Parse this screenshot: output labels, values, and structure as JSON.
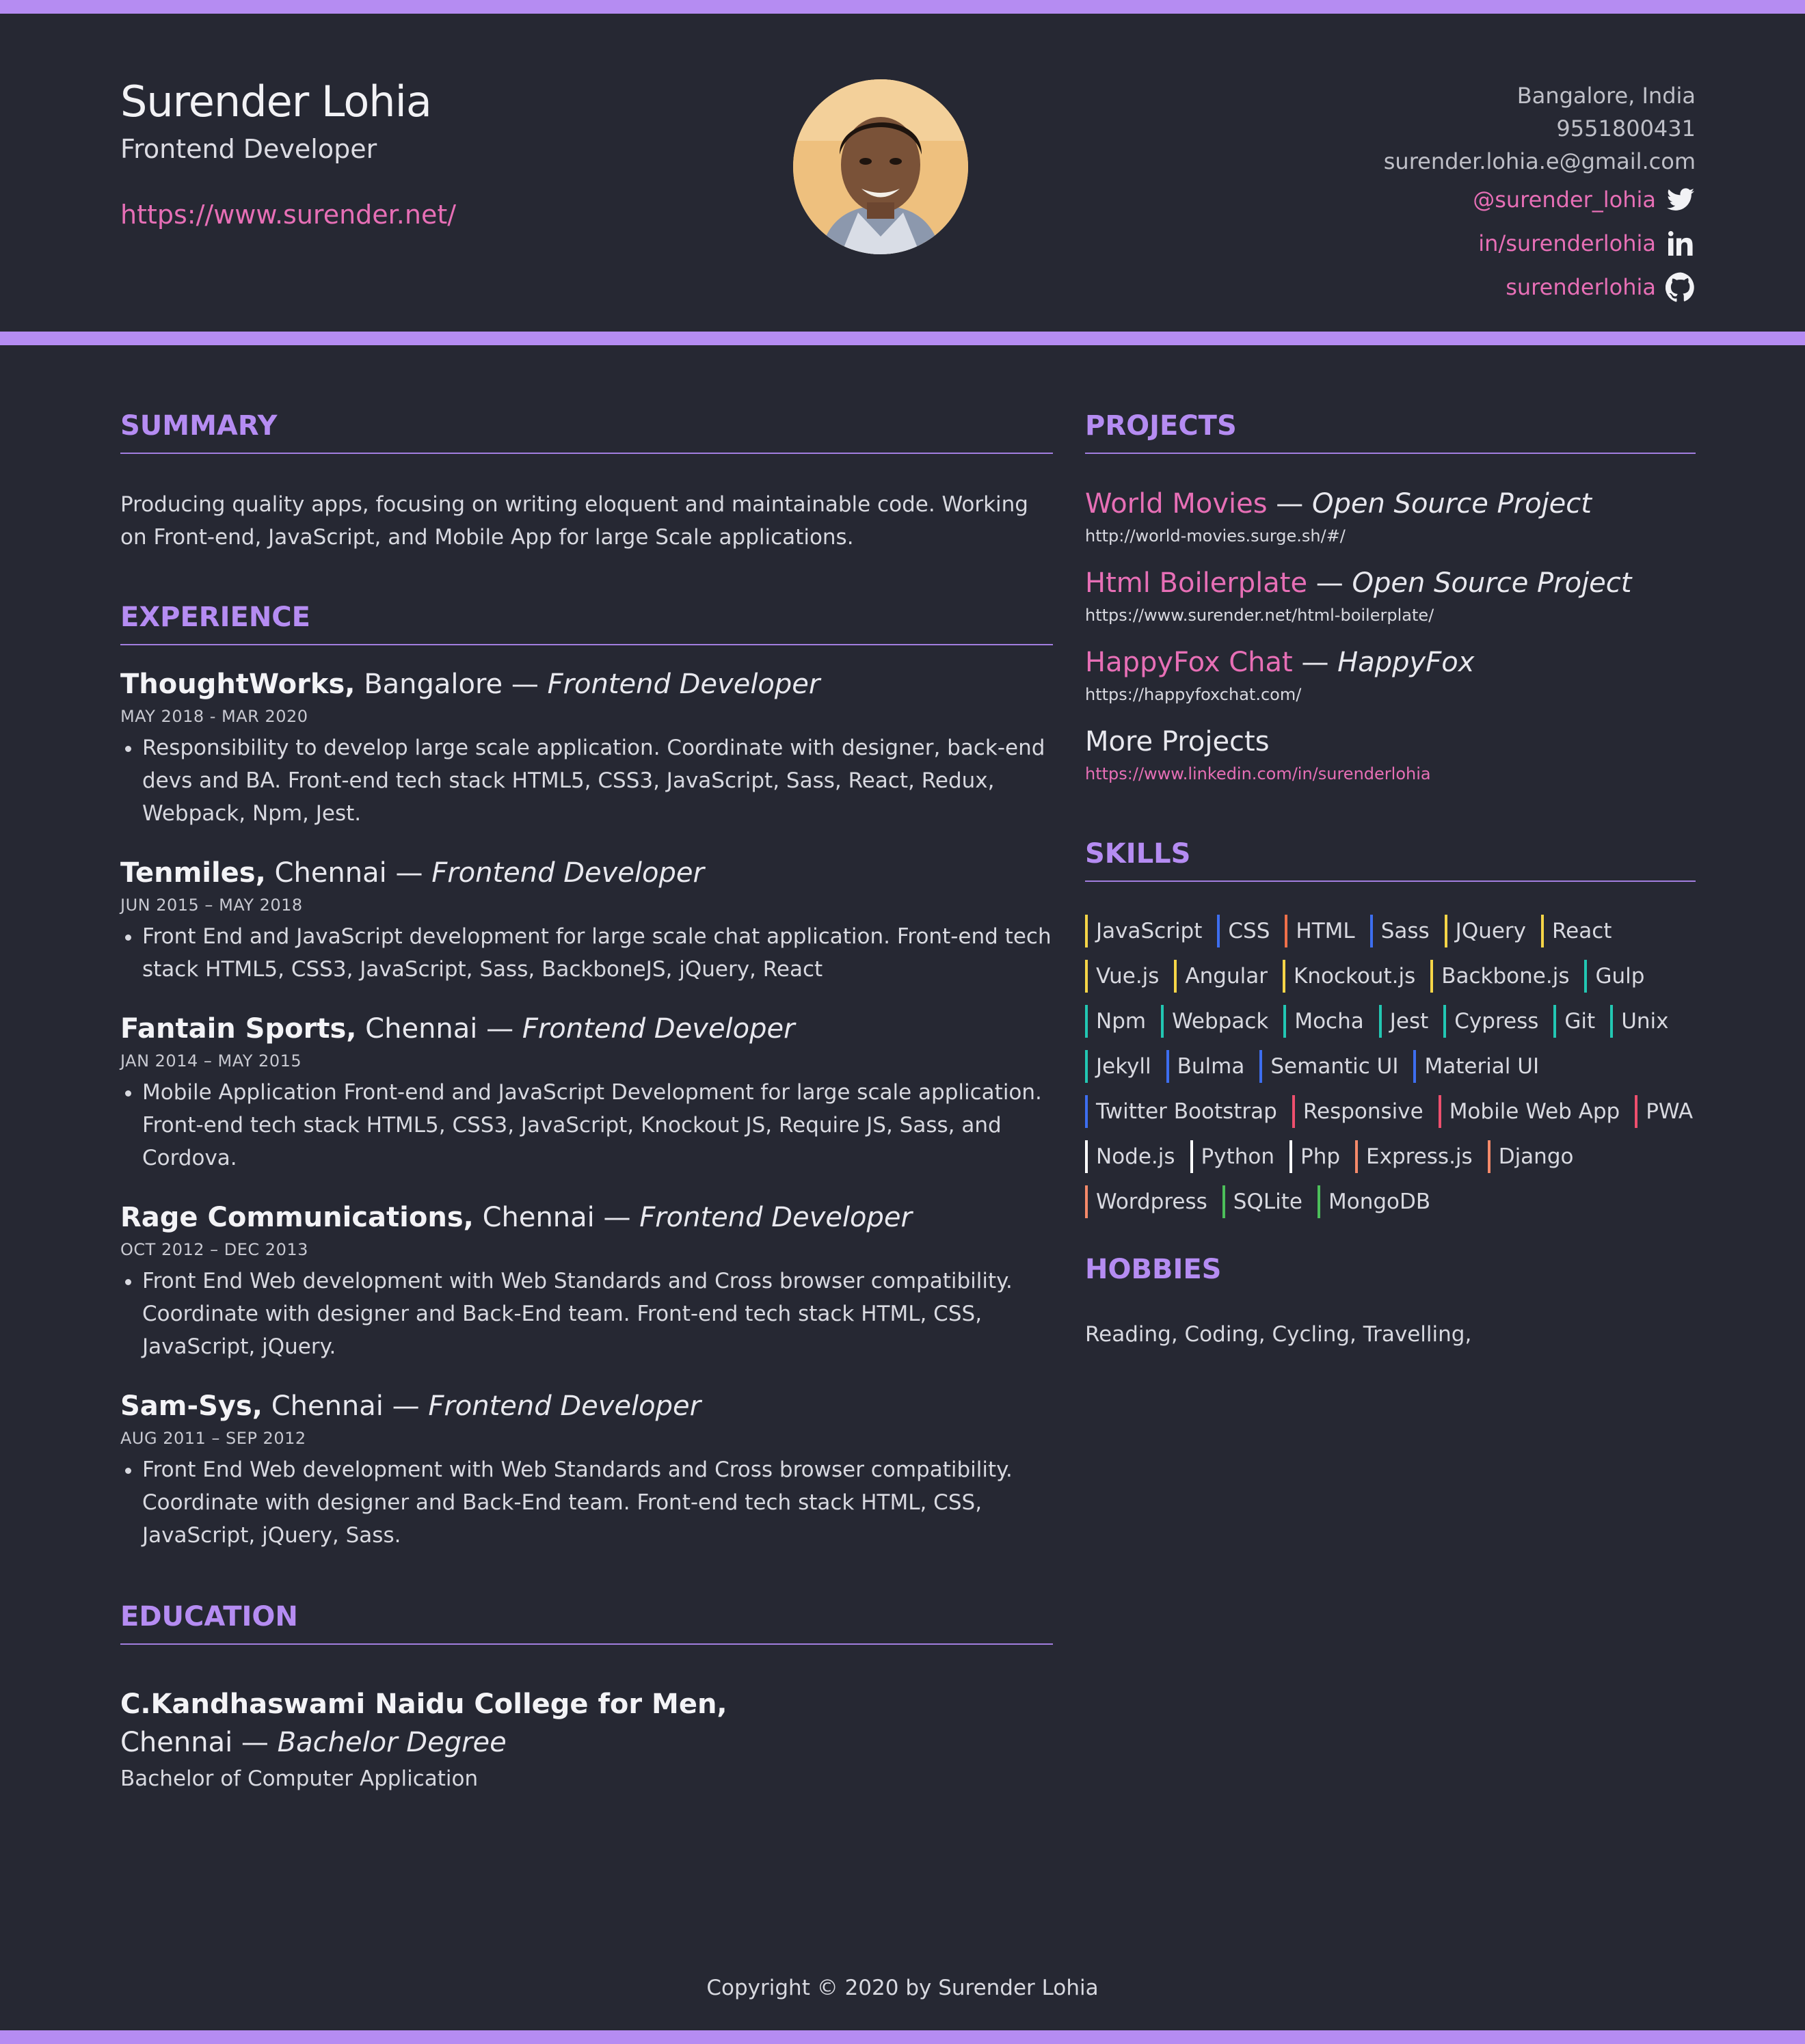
{
  "header": {
    "name": "Surender Lohia",
    "role": "Frontend Developer",
    "website": "https://www.surender.net/",
    "location": "Bangalore, India",
    "phone": "9551800431",
    "email": "surender.lohia.e@gmail.com",
    "twitter": "@surender_lohia",
    "linkedin": "in/surenderlohia",
    "github": "surenderlohia"
  },
  "summary": {
    "title": "SUMMARY",
    "text": "Producing quality apps, focusing on writing eloquent and maintainable code. Working on Front-end, JavaScript, and Mobile App for large Scale applications."
  },
  "experience": {
    "title": "EXPERIENCE",
    "jobs": [
      {
        "company": "ThoughtWorks,",
        "city": "Bangalore",
        "sep": " — ",
        "role": "Frontend Developer",
        "dates": "MAY 2018 - MAR 2020",
        "desc": "Responsibility to develop large scale application. Coordinate with designer, back-end devs and BA. Front-end tech stack HTML5, CSS3, JavaScript, Sass, React, Redux, Webpack, Npm, Jest."
      },
      {
        "company": "Tenmiles,",
        "city": "Chennai",
        "sep": " — ",
        "role": "Frontend Developer",
        "dates": "JUN 2015 – MAY 2018",
        "desc": "Front End and JavaScript development for large scale chat application. Front-end tech stack HTML5, CSS3, JavaScript, Sass, BackboneJS, jQuery, React"
      },
      {
        "company": "Fantain Sports,",
        "city": "Chennai",
        "sep": " — ",
        "role": "Frontend Developer",
        "dates": "JAN 2014 – MAY 2015",
        "desc": "Mobile Application Front-end and JavaScript Development for large scale application. Front-end tech stack HTML5, CSS3, JavaScript, Knockout JS, Require JS, Sass, and Cordova."
      },
      {
        "company": "Rage Communications,",
        "city": "Chennai",
        "sep": " — ",
        "role": "Frontend Developer",
        "dates": "OCT 2012 – DEC 2013",
        "desc": "Front End Web development with Web Standards and Cross browser compatibility. Coordinate with designer and Back-End team. Front-end tech stack HTML, CSS, JavaScript, jQuery."
      },
      {
        "company": "Sam-Sys,",
        "city": "Chennai",
        "sep": " — ",
        "role": "Frontend Developer",
        "dates": "AUG 2011 – SEP 2012",
        "desc": "Front End Web development with Web Standards and Cross browser compatibility. Coordinate with designer and Back-End team. Front-end tech stack HTML, CSS, JavaScript, jQuery, Sass."
      }
    ]
  },
  "education": {
    "title": "EDUCATION",
    "college": "C.Kandhaswami Naidu College for Men,",
    "city": "Chennai",
    "sep": " — ",
    "degree": "Bachelor Degree",
    "course": "Bachelor of Computer Application"
  },
  "projects": {
    "title": "PROJECTS",
    "items": [
      {
        "name": "World Movies",
        "sep": " — ",
        "type": "Open Source Project",
        "url": "http://world-movies.surge.sh/#/"
      },
      {
        "name": "Html Boilerplate",
        "sep": " — ",
        "type": "Open Source Project",
        "url": "https://www.surender.net/html-boilerplate/"
      },
      {
        "name": "HappyFox Chat",
        "sep": " — ",
        "type": "HappyFox",
        "url": "https://happyfoxchat.com/"
      }
    ],
    "more_label": "More Projects",
    "more_url": "https://www.linkedin.com/in/surenderlohia"
  },
  "skills": {
    "title": "SKILLS",
    "items": [
      {
        "name": "JavaScript",
        "color": "#f5d547"
      },
      {
        "name": "CSS",
        "color": "#3d6ef0"
      },
      {
        "name": "HTML",
        "color": "#f0704a"
      },
      {
        "name": "Sass",
        "color": "#3d6ef0"
      },
      {
        "name": "JQuery",
        "color": "#f5d547"
      },
      {
        "name": "React",
        "color": "#f5d547"
      },
      {
        "name": "Vue.js",
        "color": "#f5d547"
      },
      {
        "name": "Angular",
        "color": "#f5d547"
      },
      {
        "name": "Knockout.js",
        "color": "#f5d547"
      },
      {
        "name": "Backbone.js",
        "color": "#f5d547"
      },
      {
        "name": "Gulp",
        "color": "#22c7b3"
      },
      {
        "name": "Npm",
        "color": "#22c7b3"
      },
      {
        "name": "Webpack",
        "color": "#22c7b3"
      },
      {
        "name": "Mocha",
        "color": "#22c7b3"
      },
      {
        "name": "Jest",
        "color": "#22c7b3"
      },
      {
        "name": "Cypress",
        "color": "#22c7b3"
      },
      {
        "name": "Git",
        "color": "#22c7b3"
      },
      {
        "name": "Unix",
        "color": "#22c7b3"
      },
      {
        "name": "Jekyll",
        "color": "#22c7b3"
      },
      {
        "name": "Bulma",
        "color": "#3d6ef0"
      },
      {
        "name": "Semantic UI",
        "color": "#3d6ef0"
      },
      {
        "name": "Material UI",
        "color": "#3d6ef0"
      },
      {
        "name": "Twitter Bootstrap",
        "color": "#3d6ef0"
      },
      {
        "name": "Responsive",
        "color": "#ee4f6e"
      },
      {
        "name": "Mobile Web App",
        "color": "#ee4f6e"
      },
      {
        "name": "PWA",
        "color": "#ee4f6e"
      },
      {
        "name": "Node.js",
        "color": "#ffffff"
      },
      {
        "name": "Python",
        "color": "#ffffff"
      },
      {
        "name": "Php",
        "color": "#ffffff"
      },
      {
        "name": "Express.js",
        "color": "#f58a6a"
      },
      {
        "name": "Django",
        "color": "#f58a6a"
      },
      {
        "name": "Wordpress",
        "color": "#f58a6a"
      },
      {
        "name": "SQLite",
        "color": "#4cbf5a"
      },
      {
        "name": "MongoDB",
        "color": "#4cbf5a"
      }
    ]
  },
  "hobbies": {
    "title": "HOBBIES",
    "text": "Reading, Coding, Cycling, Travelling,"
  },
  "footer": {
    "text": "Copyright © 2020 by Surender Lohia"
  },
  "colors": {
    "accent": "#b58cf2",
    "link": "#e76fb6",
    "background": "#262833"
  },
  "icons": [
    "twitter-icon",
    "linkedin-icon",
    "github-icon"
  ]
}
